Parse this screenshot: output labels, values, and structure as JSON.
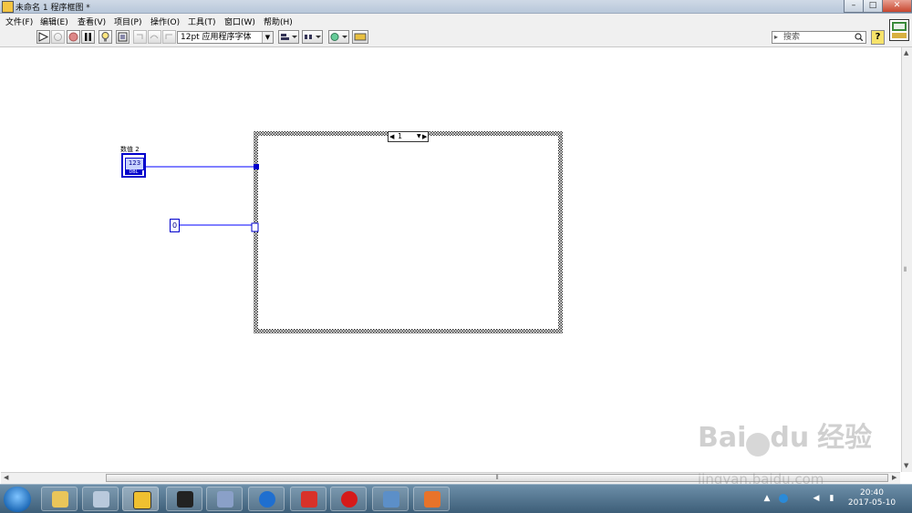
{
  "window": {
    "title": "未命名 1 程序框图 *",
    "controls": {
      "minimize": "–",
      "maximize": "□",
      "close": "✕"
    }
  },
  "menu": {
    "items": [
      "文件(F)",
      "编辑(E)",
      "查看(V)",
      "项目(P)",
      "操作(O)",
      "工具(T)",
      "窗口(W)",
      "帮助(H)"
    ]
  },
  "toolbar": {
    "font_select": "12pt 应用程序字体",
    "font_select_arrow": "▼",
    "search_placeholder": "搜索",
    "search_lead": "▸",
    "help_label": "?"
  },
  "diagram": {
    "numeric_label": "数值 2",
    "numeric_terminal_text": "123",
    "numeric_terminal_type": "DBL",
    "constant_value": "0",
    "case_selector_value": "1",
    "case_selector_arrow": "▼",
    "colors": {
      "wire": "#0000ff",
      "terminal": "#0000cc"
    }
  },
  "scrollbars": {
    "grip": "⦀"
  },
  "taskbar": {
    "time": "20:40",
    "date": "2017-05-10",
    "apps": [
      "file-explorer",
      "calculator",
      "labview",
      "chip-tool",
      "serial-port",
      "teamviewer",
      "swirl-app",
      "opera",
      "remote-desktop",
      "powerpoint"
    ]
  },
  "watermark": {
    "logo_left": "Bai",
    "logo_right": "du",
    "logo_cn": "经验",
    "url": "jingyan.baidu.com"
  }
}
